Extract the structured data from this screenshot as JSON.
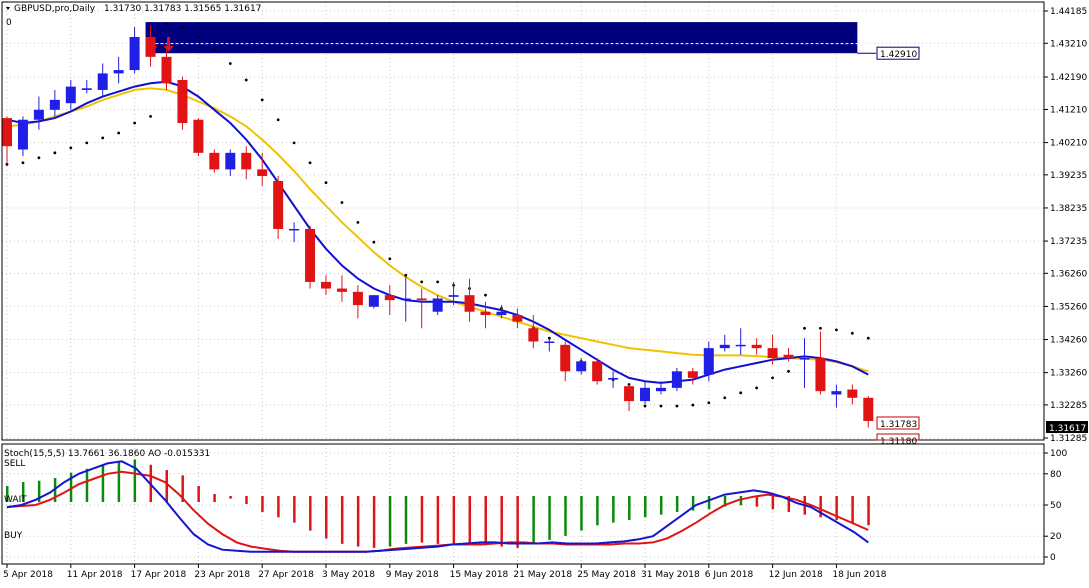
{
  "window": {
    "symbol_info": "GBPUSD,pro,Daily",
    "ohlc": "1.31730 1.31783 1.31565 1.31617",
    "subwindow_index": "0"
  },
  "price_axis": {
    "ticks": [
      "1.44185",
      "1.43210",
      "1.42190",
      "1.41210",
      "1.40210",
      "1.39235",
      "1.38235",
      "1.37235",
      "1.36260",
      "1.35260",
      "1.34260",
      "1.33260",
      "1.32285",
      "1.31285"
    ],
    "tick_values": [
      1.44185,
      1.4321,
      1.4219,
      1.4121,
      1.4021,
      1.39235,
      1.38235,
      1.37235,
      1.3626,
      1.3526,
      1.3426,
      1.3326,
      1.32285,
      1.31285
    ],
    "current_price_label": "1.31617",
    "resistance_label": "1.42910",
    "ask_label": "1.31783",
    "bid_label": "1.31180"
  },
  "oscillator": {
    "header": "Stoch(15,5,5) 13.7661 36.1860  AO -0.015331",
    "label_sell": "SELL",
    "label_wait": "WAIT",
    "label_buy": "BUY",
    "axis_ticks": [
      "100",
      "80",
      "50",
      "20",
      "0"
    ],
    "axis_tick_values": [
      100,
      80,
      50,
      20,
      0
    ]
  },
  "time_axis": {
    "labels": [
      "5 Apr 2018",
      "11 Apr 2018",
      "17 Apr 2018",
      "23 Apr 2018",
      "27 Apr 2018",
      "3 May 2018",
      "9 May 2018",
      "15 May 2018",
      "21 May 2018",
      "25 May 2018",
      "31 May 2018",
      "6 Jun 2018",
      "12 Jun 2018",
      "18 Jun 2018"
    ]
  },
  "colors": {
    "bull": "#1f1fe6",
    "bear": "#e01414",
    "ma_fast": "#1010d0",
    "ma_slow": "#f2c200",
    "zone": "#00007f",
    "ao_up": "#0a8a0a",
    "ao_down": "#e01414",
    "stoch_main": "#1515d0",
    "stoch_signal": "#e01414"
  },
  "chart_data": {
    "type": "candlestick",
    "series_candles": [
      {
        "o": 1.4095,
        "h": 1.41,
        "l": 1.396,
        "c": 1.401
      },
      {
        "o": 1.4,
        "h": 1.41,
        "l": 1.398,
        "c": 1.409
      },
      {
        "o": 1.409,
        "h": 1.416,
        "l": 1.406,
        "c": 1.412
      },
      {
        "o": 1.412,
        "h": 1.418,
        "l": 1.41,
        "c": 1.415
      },
      {
        "o": 1.414,
        "h": 1.421,
        "l": 1.412,
        "c": 1.419
      },
      {
        "o": 1.418,
        "h": 1.421,
        "l": 1.417,
        "c": 1.4185
      },
      {
        "o": 1.418,
        "h": 1.426,
        "l": 1.416,
        "c": 1.423
      },
      {
        "o": 1.423,
        "h": 1.428,
        "l": 1.42,
        "c": 1.424
      },
      {
        "o": 1.424,
        "h": 1.437,
        "l": 1.423,
        "c": 1.434
      },
      {
        "o": 1.434,
        "h": 1.4375,
        "l": 1.425,
        "c": 1.428
      },
      {
        "o": 1.428,
        "h": 1.43,
        "l": 1.418,
        "c": 1.42
      },
      {
        "o": 1.421,
        "h": 1.422,
        "l": 1.406,
        "c": 1.408
      },
      {
        "o": 1.409,
        "h": 1.4095,
        "l": 1.398,
        "c": 1.399
      },
      {
        "o": 1.399,
        "h": 1.4,
        "l": 1.393,
        "c": 1.394
      },
      {
        "o": 1.394,
        "h": 1.4,
        "l": 1.392,
        "c": 1.399
      },
      {
        "o": 1.399,
        "h": 1.401,
        "l": 1.391,
        "c": 1.394
      },
      {
        "o": 1.394,
        "h": 1.399,
        "l": 1.389,
        "c": 1.392
      },
      {
        "o": 1.3905,
        "h": 1.392,
        "l": 1.373,
        "c": 1.376
      },
      {
        "o": 1.376,
        "h": 1.378,
        "l": 1.372,
        "c": 1.376
      },
      {
        "o": 1.376,
        "h": 1.377,
        "l": 1.358,
        "c": 1.36
      },
      {
        "o": 1.36,
        "h": 1.362,
        "l": 1.356,
        "c": 1.358
      },
      {
        "o": 1.358,
        "h": 1.362,
        "l": 1.354,
        "c": 1.357
      },
      {
        "o": 1.357,
        "h": 1.359,
        "l": 1.349,
        "c": 1.353
      },
      {
        "o": 1.3525,
        "h": 1.356,
        "l": 1.352,
        "c": 1.356
      },
      {
        "o": 1.356,
        "h": 1.359,
        "l": 1.35,
        "c": 1.3545
      },
      {
        "o": 1.3545,
        "h": 1.362,
        "l": 1.348,
        "c": 1.355
      },
      {
        "o": 1.355,
        "h": 1.358,
        "l": 1.346,
        "c": 1.3545
      },
      {
        "o": 1.351,
        "h": 1.356,
        "l": 1.35,
        "c": 1.355
      },
      {
        "o": 1.3555,
        "h": 1.36,
        "l": 1.353,
        "c": 1.356
      },
      {
        "o": 1.356,
        "h": 1.361,
        "l": 1.348,
        "c": 1.351
      },
      {
        "o": 1.351,
        "h": 1.354,
        "l": 1.346,
        "c": 1.35
      },
      {
        "o": 1.35,
        "h": 1.353,
        "l": 1.349,
        "c": 1.351
      },
      {
        "o": 1.35,
        "h": 1.352,
        "l": 1.346,
        "c": 1.348
      },
      {
        "o": 1.346,
        "h": 1.35,
        "l": 1.34,
        "c": 1.342
      },
      {
        "o": 1.342,
        "h": 1.343,
        "l": 1.339,
        "c": 1.342
      },
      {
        "o": 1.341,
        "h": 1.342,
        "l": 1.33,
        "c": 1.333
      },
      {
        "o": 1.333,
        "h": 1.337,
        "l": 1.332,
        "c": 1.336
      },
      {
        "o": 1.336,
        "h": 1.337,
        "l": 1.329,
        "c": 1.33
      },
      {
        "o": 1.3305,
        "h": 1.333,
        "l": 1.328,
        "c": 1.331
      },
      {
        "o": 1.3285,
        "h": 1.329,
        "l": 1.321,
        "c": 1.324
      },
      {
        "o": 1.324,
        "h": 1.33,
        "l": 1.323,
        "c": 1.328
      },
      {
        "o": 1.327,
        "h": 1.33,
        "l": 1.326,
        "c": 1.328
      },
      {
        "o": 1.328,
        "h": 1.334,
        "l": 1.327,
        "c": 1.333
      },
      {
        "o": 1.333,
        "h": 1.334,
        "l": 1.329,
        "c": 1.331
      },
      {
        "o": 1.332,
        "h": 1.342,
        "l": 1.33,
        "c": 1.34
      },
      {
        "o": 1.34,
        "h": 1.344,
        "l": 1.339,
        "c": 1.341
      },
      {
        "o": 1.341,
        "h": 1.346,
        "l": 1.338,
        "c": 1.341
      },
      {
        "o": 1.341,
        "h": 1.343,
        "l": 1.338,
        "c": 1.34
      },
      {
        "o": 1.34,
        "h": 1.344,
        "l": 1.335,
        "c": 1.337
      },
      {
        "o": 1.338,
        "h": 1.34,
        "l": 1.336,
        "c": 1.337
      },
      {
        "o": 1.337,
        "h": 1.343,
        "l": 1.328,
        "c": 1.337
      },
      {
        "o": 1.337,
        "h": 1.345,
        "l": 1.326,
        "c": 1.327
      },
      {
        "o": 1.326,
        "h": 1.329,
        "l": 1.322,
        "c": 1.327
      },
      {
        "o": 1.3275,
        "h": 1.329,
        "l": 1.323,
        "c": 1.325
      },
      {
        "o": 1.325,
        "h": 1.3255,
        "l": 1.316,
        "c": 1.318
      },
      {
        "o": 1.3173,
        "h": 1.3178,
        "l": 1.3157,
        "c": 1.3162
      }
    ],
    "ma_fast": [
      1.409,
      1.408,
      1.4085,
      1.4095,
      1.4115,
      1.414,
      1.416,
      1.4175,
      1.419,
      1.42,
      1.4205,
      1.419,
      1.416,
      1.412,
      1.408,
      1.403,
      1.397,
      1.39,
      1.383,
      1.376,
      1.37,
      1.365,
      1.361,
      1.358,
      1.356,
      1.3545,
      1.354,
      1.354,
      1.354,
      1.3535,
      1.3525,
      1.3515,
      1.35,
      1.348,
      1.3455,
      1.3425,
      1.3395,
      1.3365,
      1.3335,
      1.331,
      1.33,
      1.3295,
      1.33,
      1.3305,
      1.332,
      1.3335,
      1.3345,
      1.3355,
      1.3365,
      1.337,
      1.3375,
      1.337,
      1.336,
      1.3345,
      1.332
    ],
    "ma_slow": [
      1.407,
      1.4075,
      1.4085,
      1.41,
      1.4115,
      1.413,
      1.415,
      1.4165,
      1.418,
      1.4185,
      1.418,
      1.4165,
      1.4145,
      1.4125,
      1.41,
      1.407,
      1.403,
      1.3985,
      1.3935,
      1.388,
      1.383,
      1.378,
      1.3735,
      1.369,
      1.365,
      1.3615,
      1.3585,
      1.356,
      1.354,
      1.3525,
      1.351,
      1.3495,
      1.348,
      1.3465,
      1.345,
      1.344,
      1.343,
      1.342,
      1.341,
      1.34,
      1.3395,
      1.339,
      1.3385,
      1.338,
      1.3378,
      1.3378,
      1.3378,
      1.3376,
      1.3373,
      1.337,
      1.3368,
      1.3365,
      1.3358,
      1.3345,
      1.333
    ],
    "sar": [
      1.3955,
      1.396,
      1.3975,
      1.399,
      1.4005,
      1.402,
      1.4035,
      1.405,
      1.408,
      1.41,
      1.438,
      1.437,
      1.434,
      1.43,
      1.426,
      1.421,
      1.415,
      1.409,
      1.402,
      1.396,
      1.39,
      1.384,
      1.378,
      1.372,
      1.367,
      1.362,
      1.36,
      1.36,
      1.359,
      1.358,
      1.356,
      1.352,
      1.349,
      1.346,
      1.343,
      1.34,
      1.336,
      1.333,
      1.3305,
      1.329,
      1.3225,
      1.3225,
      1.3225,
      1.3228,
      1.3235,
      1.325,
      1.3265,
      1.328,
      1.331,
      1.333,
      1.346,
      1.346,
      1.3455,
      1.3445,
      1.343
    ],
    "resistance_zone": {
      "top": 1.4385,
      "bottom": 1.4291,
      "start_index": 9,
      "end_index": 53
    },
    "sell_arrows": [
      9,
      10
    ],
    "ao": [
      0.006,
      0.0075,
      0.008,
      0.009,
      0.011,
      0.0125,
      0.014,
      0.015,
      0.016,
      0.014,
      0.012,
      0.01,
      0.006,
      0.003,
      -0.001,
      -0.003,
      -0.006,
      -0.008,
      -0.01,
      -0.013,
      -0.016,
      -0.018,
      -0.019,
      -0.0195,
      -0.019,
      -0.018,
      -0.0175,
      -0.018,
      -0.0185,
      -0.0185,
      -0.0185,
      -0.019,
      -0.0195,
      -0.018,
      -0.0165,
      -0.015,
      -0.013,
      -0.011,
      -0.01,
      -0.009,
      -0.008,
      -0.007,
      -0.006,
      -0.0055,
      -0.005,
      -0.004,
      -0.0035,
      -0.004,
      -0.005,
      -0.006,
      -0.007,
      -0.008,
      -0.009,
      -0.01,
      -0.011
    ],
    "ao_color": [
      "u",
      "u",
      "u",
      "u",
      "u",
      "u",
      "u",
      "u",
      "u",
      "d",
      "d",
      "d",
      "d",
      "d",
      "d",
      "d",
      "d",
      "d",
      "d",
      "d",
      "d",
      "d",
      "d",
      "d",
      "u",
      "u",
      "d",
      "d",
      "d",
      "d",
      "d",
      "d",
      "d",
      "u",
      "u",
      "u",
      "u",
      "u",
      "u",
      "u",
      "u",
      "u",
      "u",
      "u",
      "u",
      "u",
      "u",
      "d",
      "d",
      "d",
      "d",
      "d",
      "d",
      "d",
      "d"
    ],
    "stoch_main": [
      48,
      50,
      55,
      62,
      72,
      80,
      85,
      90,
      92,
      85,
      70,
      55,
      38,
      22,
      12,
      7,
      6,
      5,
      5,
      5,
      5,
      5,
      5,
      5,
      5,
      5,
      6,
      7,
      8,
      9,
      10,
      12,
      13,
      14,
      14,
      13,
      13,
      13,
      14,
      13,
      13,
      13,
      14,
      15,
      17,
      20,
      30,
      40,
      50,
      55,
      60,
      62,
      64,
      62,
      58,
      52,
      48,
      40,
      32,
      24,
      14
    ],
    "stoch_signal": [
      48,
      49,
      50,
      55,
      62,
      70,
      75,
      80,
      82,
      80,
      78,
      72,
      60,
      45,
      32,
      22,
      14,
      10,
      8,
      6,
      5,
      5,
      5,
      5,
      5,
      5,
      6,
      8,
      9,
      10,
      11,
      12,
      12,
      12,
      13,
      14,
      14,
      13,
      13,
      12,
      12,
      12,
      12,
      13,
      13,
      14,
      18,
      25,
      33,
      42,
      50,
      55,
      58,
      60,
      58,
      55,
      50,
      44,
      38,
      32,
      26
    ]
  }
}
